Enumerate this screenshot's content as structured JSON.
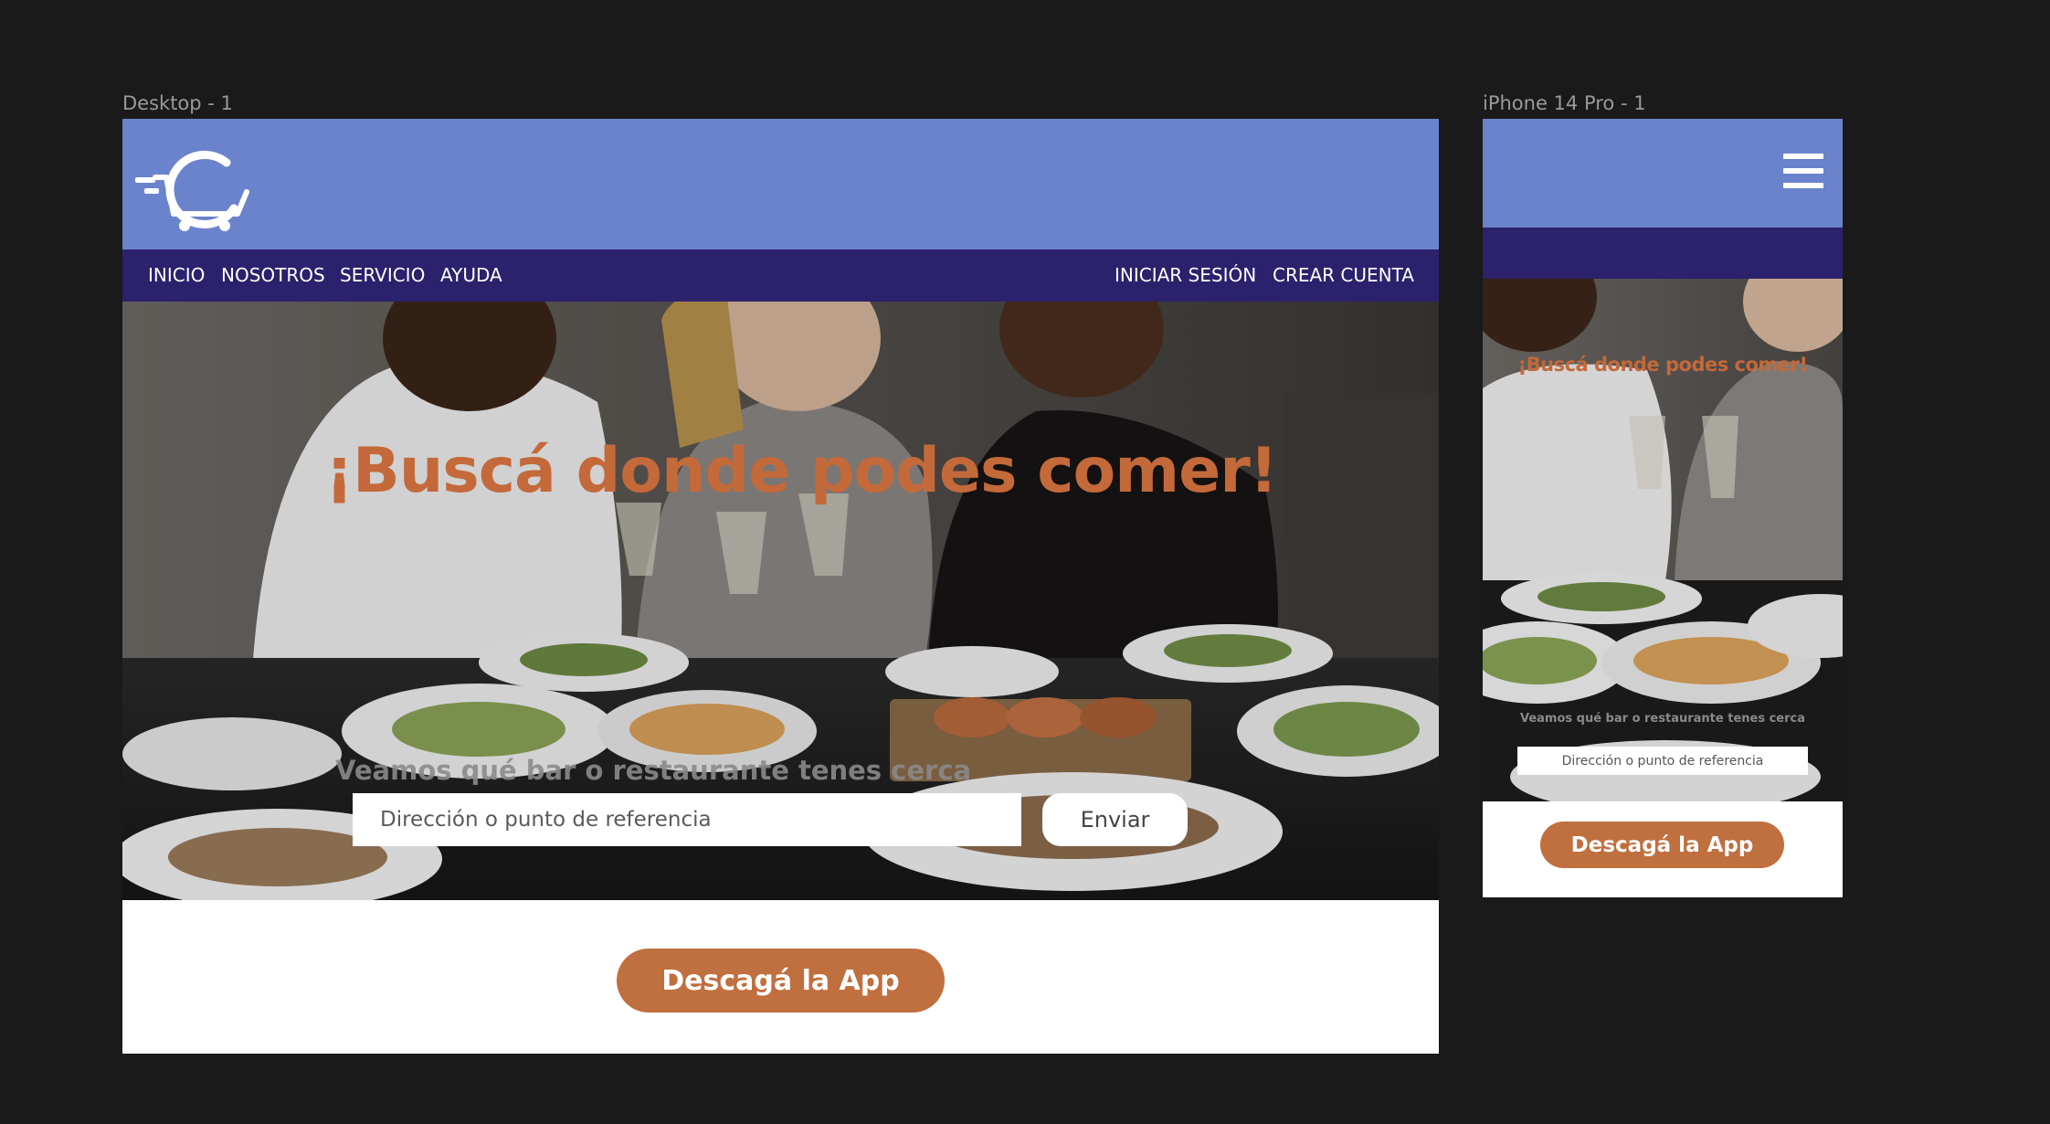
{
  "canvas": {
    "frames": [
      {
        "label": "Desktop - 1"
      },
      {
        "label": "iPhone 14 Pro - 1"
      }
    ]
  },
  "colors": {
    "header_bg": "#6b83cc",
    "nav_bg": "#2b216c",
    "accent": "#c06f3f",
    "hero_title": "#c4693a",
    "canvas_bg": "#1a1a1a"
  },
  "desktop": {
    "logo_icon": "cart-c-logo-icon",
    "nav": {
      "left": [
        "INICIO",
        "NOSOTROS",
        "SERVICIO",
        "AYUDA"
      ],
      "right": [
        "INICIAR SESIÓN",
        "CREAR CUENTA"
      ]
    },
    "hero": {
      "title": "¡Buscá donde podes comer!",
      "subtitle": "Veamos qué bar o restaurante tenes cerca",
      "input_placeholder": "Dirección o punto de referencia",
      "submit_label": "Enviar"
    },
    "cta_label": "Descagá la App"
  },
  "mobile": {
    "menu_icon": "hamburger-menu-icon",
    "hero": {
      "title": "¡Buscá donde podes comer!",
      "subtitle": "Veamos qué bar o restaurante tenes cerca",
      "input_placeholder": "Dirección o punto de referencia"
    },
    "cta_label": "Descagá la App"
  }
}
